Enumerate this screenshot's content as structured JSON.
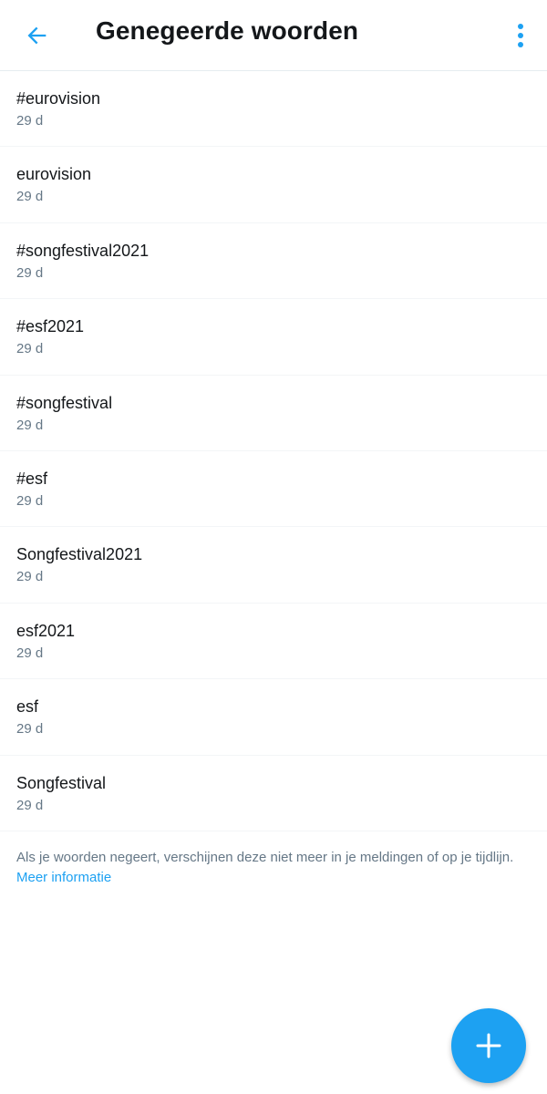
{
  "header": {
    "title": "Genegeerde woorden",
    "back_icon": "arrow-left-icon",
    "more_icon": "more-vertical-icon",
    "accent_color": "#1da1f2"
  },
  "muted_words": [
    {
      "word": "#eurovision",
      "time": "29 d"
    },
    {
      "word": "eurovision",
      "time": "29 d"
    },
    {
      "word": "#songfestival2021",
      "time": "29 d"
    },
    {
      "word": "#esf2021",
      "time": "29 d"
    },
    {
      "word": "#songfestival",
      "time": "29 d"
    },
    {
      "word": "#esf",
      "time": "29 d"
    },
    {
      "word": "Songfestival2021",
      "time": "29 d"
    },
    {
      "word": "esf2021",
      "time": "29 d"
    },
    {
      "word": "esf",
      "time": "29 d"
    },
    {
      "word": "Songfestival",
      "time": "29 d"
    }
  ],
  "info": {
    "text": "Als je woorden negeert, verschijnen deze niet meer in je meldingen of op je tijdlijn. ",
    "link": "Meer informatie"
  },
  "fab": {
    "icon": "plus-icon",
    "color": "#1da1f2"
  }
}
